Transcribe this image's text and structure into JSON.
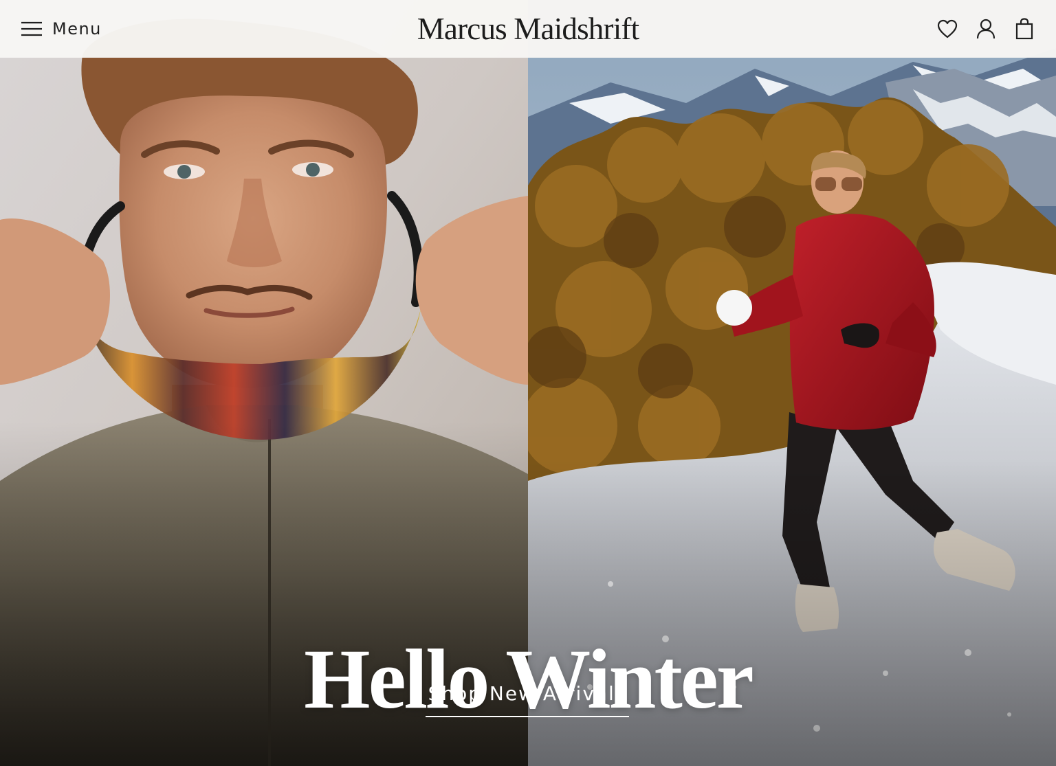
{
  "header": {
    "menu_label": "Menu",
    "brand": "Marcus Maidshrift",
    "icons": {
      "menu": "hamburger-icon",
      "wishlist": "heart-icon",
      "account": "user-icon",
      "cart": "shopping-bag-icon"
    }
  },
  "hero": {
    "title": "Hello Winter",
    "cta_label": "Shop New Arrivals",
    "images": {
      "left": "man-holding-sport-sunglasses",
      "right": "woman-in-red-puffer-jacket-in-snow"
    }
  },
  "colors": {
    "header_bg": "#f7f6f4",
    "text_dark": "#1c1c1c",
    "hero_text": "#ffffff",
    "jacket_red": "#a3131a"
  }
}
